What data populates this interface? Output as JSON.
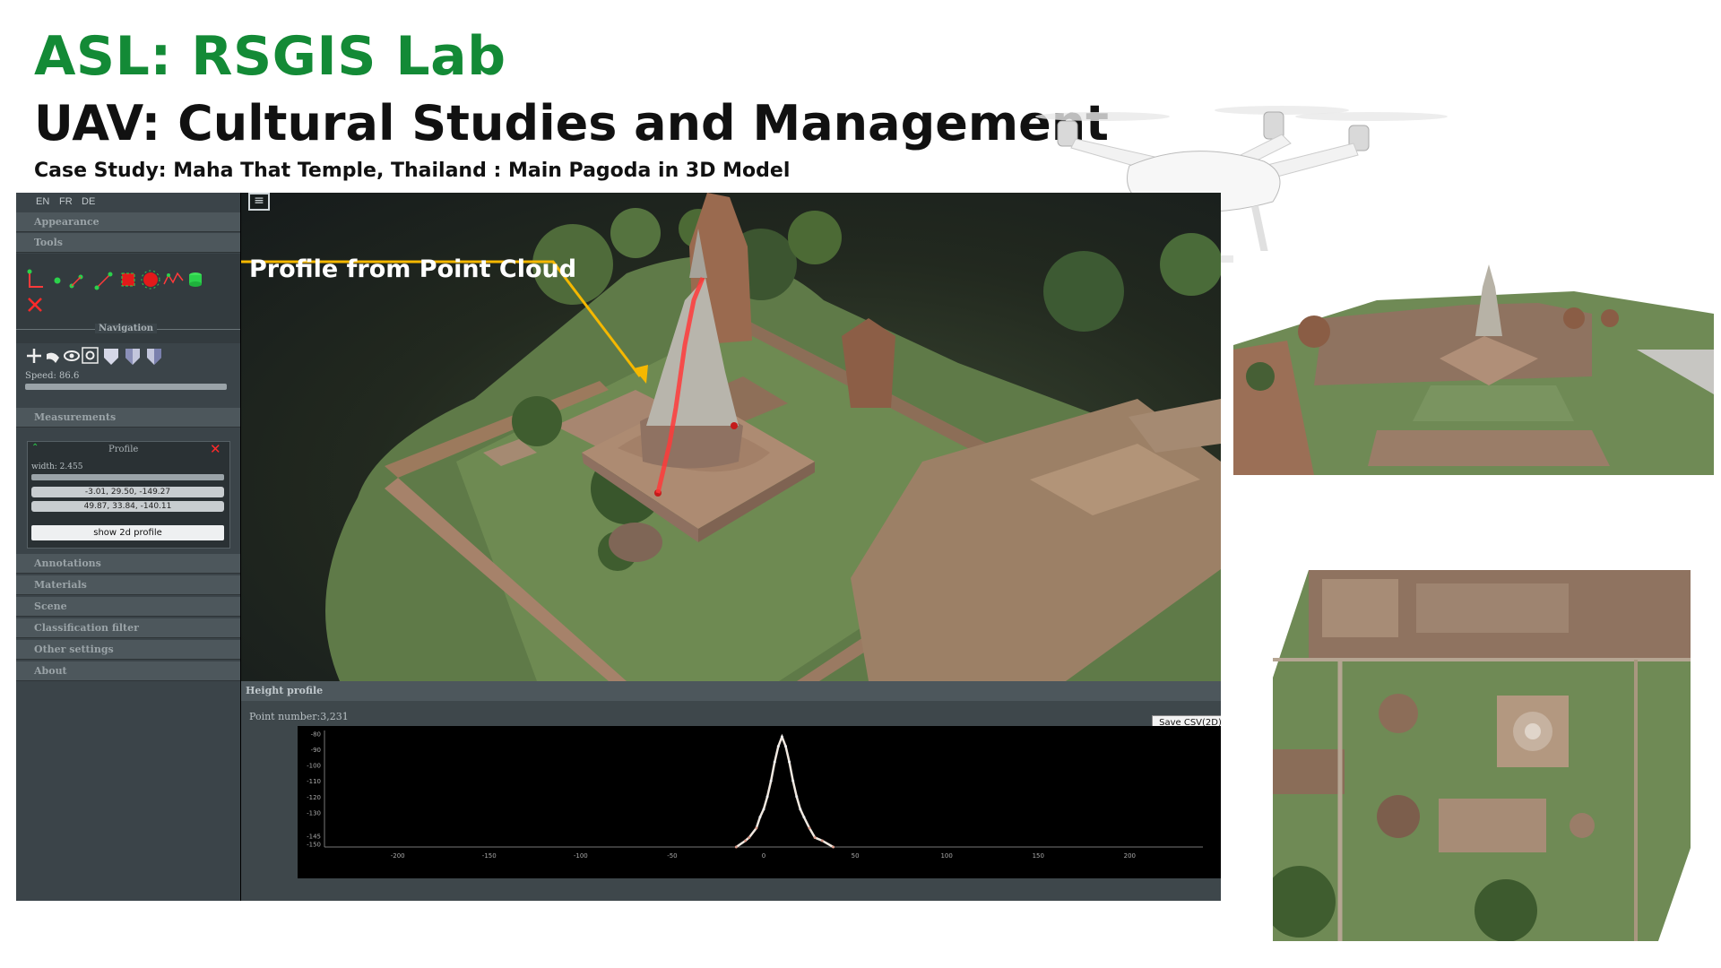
{
  "header": {
    "lab": "ASL: RSGIS Lab",
    "title": "UAV: Cultural Studies and Management",
    "case": "Case  Study: Maha That Temple, Thailand : Main Pagoda in 3D Model"
  },
  "colors": {
    "lab_green": "#138a36",
    "arrow_yellow": "#f5b800",
    "profile_red": "#ff3030"
  },
  "sidebar": {
    "languages": [
      "EN",
      "FR",
      "DE"
    ],
    "sections_top": [
      "Appearance",
      "Tools"
    ],
    "navigation_label": "Navigation",
    "speed": "Speed: 86.6",
    "measurements_label": "Measurements",
    "profile": {
      "title": "Profile",
      "width": "width: 2.455",
      "point1": "-3.01, 29.50, -149.27",
      "point2": "49.87, 33.84, -140.11",
      "button": "show 2d profile"
    },
    "sections_bottom": [
      "Annotations",
      "Materials",
      "Scene",
      "Classification filter",
      "Other settings",
      "About"
    ]
  },
  "viewport": {
    "annotation": "Profile from Point Cloud"
  },
  "height_profile": {
    "title": "Height profile",
    "point_number": "Point number:3,231",
    "save_button": "Save CSV(2D)"
  },
  "chart_data": {
    "type": "line",
    "title": "Height profile",
    "xlabel": "",
    "ylabel": "",
    "x_ticks": [
      -200,
      -150,
      -100,
      -50,
      0,
      50,
      100,
      150,
      200
    ],
    "y_ticks": [
      -80,
      -90,
      -100,
      -110,
      -120,
      -130,
      -145,
      -150
    ],
    "xlim": [
      -240,
      240
    ],
    "ylim": [
      -152,
      -78
    ],
    "series": [
      {
        "x": [
          -15,
          -10,
          -8,
          -4,
          -2,
          0,
          2,
          4,
          6,
          8,
          10,
          12,
          14,
          16,
          18,
          20,
          22,
          25,
          28,
          32,
          38
        ],
        "y": [
          -152,
          -148,
          -146,
          -140,
          -133,
          -128,
          -120,
          -110,
          -98,
          -88,
          -82,
          -88,
          -98,
          -110,
          -120,
          -128,
          -133,
          -140,
          -146,
          -148,
          -152
        ]
      }
    ]
  }
}
